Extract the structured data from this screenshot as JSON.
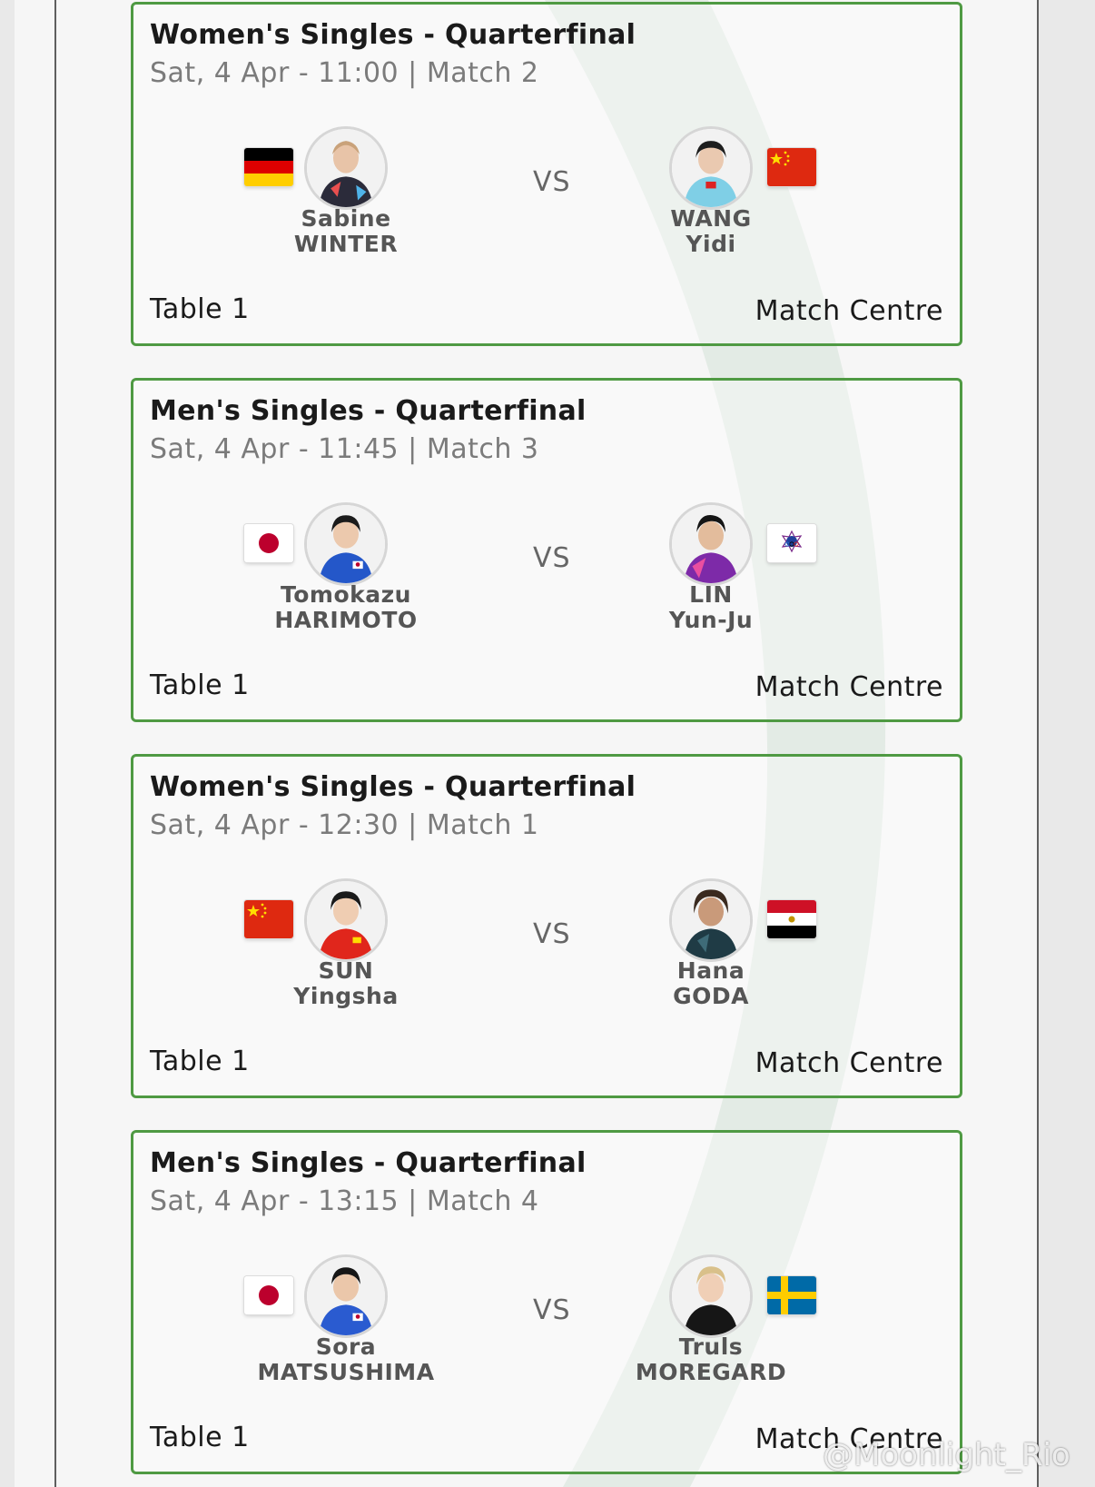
{
  "accent_color": "#4f9a43",
  "cards": [
    {
      "title": "Women's Singles - Quarterfinal",
      "subtitle": "Sat, 4 Apr - 11:00 | Match 2",
      "vs": "VS",
      "table": "Table 1",
      "link": "Match Centre",
      "left": {
        "first": "Sabine",
        "second": "WINTER",
        "flag": "germany-flag-icon"
      },
      "right": {
        "first": "WANG",
        "second": "Yidi",
        "flag": "china-flag-icon"
      }
    },
    {
      "title": "Men's Singles - Quarterfinal",
      "subtitle": "Sat, 4 Apr - 11:45 | Match 3",
      "vs": "VS",
      "table": "Table 1",
      "link": "Match Centre",
      "left": {
        "first": "Tomokazu",
        "second": "HARIMOTO",
        "flag": "japan-flag-icon"
      },
      "right": {
        "first": "LIN",
        "second": "Yun-Ju",
        "flag": "chinese-taipei-flag-icon"
      }
    },
    {
      "title": "Women's Singles - Quarterfinal",
      "subtitle": "Sat, 4 Apr - 12:30 | Match 1",
      "vs": "VS",
      "table": "Table 1",
      "link": "Match Centre",
      "left": {
        "first": "SUN",
        "second": "Yingsha",
        "flag": "china-flag-icon"
      },
      "right": {
        "first": "Hana",
        "second": "GODA",
        "flag": "egypt-flag-icon"
      }
    },
    {
      "title": "Men's Singles - Quarterfinal",
      "subtitle": "Sat, 4 Apr - 13:15 | Match 4",
      "vs": "VS",
      "table": "Table 1",
      "link": "Match Centre",
      "left": {
        "first": "Sora",
        "second": "MATSUSHIMA",
        "flag": "japan-flag-icon"
      },
      "right": {
        "first": "Truls",
        "second": "MOREGARD",
        "flag": "sweden-flag-icon"
      }
    }
  ],
  "watermark": "@Moonlight_Rio"
}
